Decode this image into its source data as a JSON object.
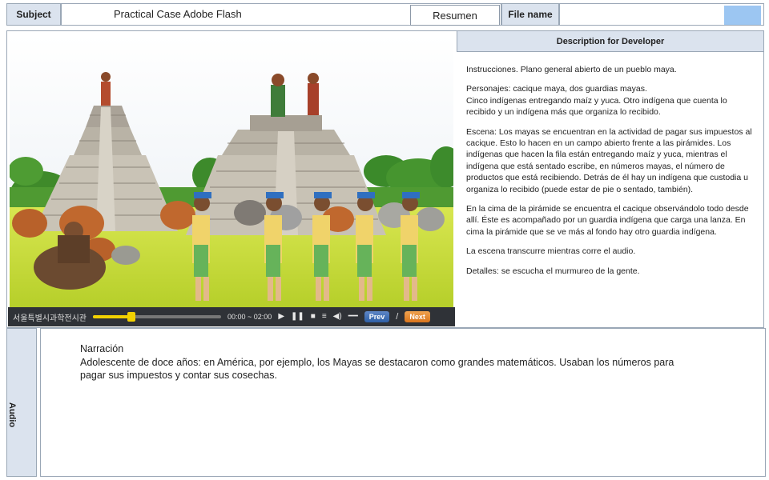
{
  "header": {
    "subject_label": "Subject",
    "subject_value": "Practical Case Adobe Flash",
    "resumen_button": "Resumen",
    "file_name_label": "File name",
    "file_name_value": ""
  },
  "player": {
    "logo_text": "서울특별시과학전시관",
    "time": "00:00 ~ 02:00",
    "prev_label": "Prev",
    "next_label": "Next",
    "progress": 0.3
  },
  "description": {
    "header": "Description for Developer",
    "paragraphs": [
      "Instrucciones. Plano general abierto de un pueblo maya.",
      "Personajes: cacique maya, dos guardias mayas.\nCinco indígenas entregando maíz y yuca. Otro indígena que cuenta lo recibido y un indígena más que organiza lo recibido.",
      "Escena: Los mayas se encuentran en la actividad de pagar sus impuestos al cacique. Esto lo hacen en un campo abierto frente a las pirámides. Los indígenas que hacen la fila están entregando maíz y yuca, mientras el indígena que está sentado escribe, en números mayas, el número de productos que está recibiendo. Detrás de él hay un indígena que custodia u organiza lo recibido (puede estar de pie o sentado, también).",
      "En la cima de la pirámide se encuentra el cacique observándolo todo desde allí. Éste es acompañado por un guardia indígena que carga una lanza. En cima la pirámide que se ve más al fondo hay otro guardia indígena.",
      "La escena transcurre mientras corre el audio.",
      "Detalles: se escucha el murmureo de la gente."
    ]
  },
  "audio": {
    "tab_label": "Audio",
    "narration_title": "Narración",
    "narration_text": "Adolescente de doce años: en América,  por ejemplo, los Mayas se destacaron como grandes matemáticos. Usaban los números para pagar sus impuestos y contar sus cosechas."
  },
  "colors": {
    "tab_bg": "#dbe3ee",
    "border": "#9aa7b6",
    "accent_blue": "#9cc6f2",
    "player_bg": "#2f3237",
    "progress_yellow": "#f2d100"
  }
}
